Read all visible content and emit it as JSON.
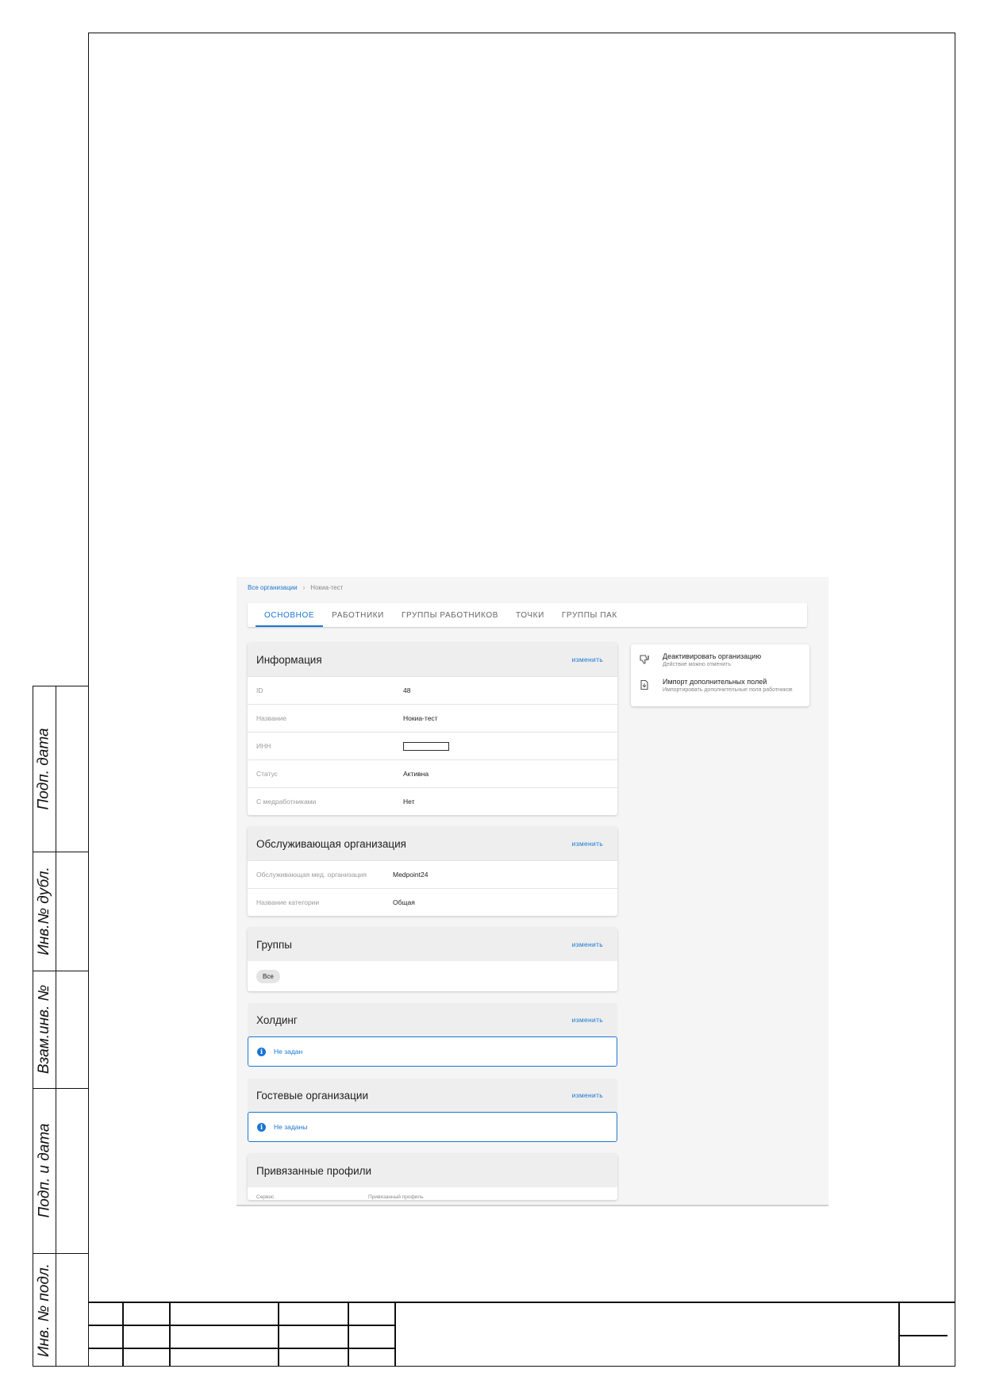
{
  "side_labels": [
    "Подп. дата",
    "Инв.№ дубл.",
    "Взам.инв. №",
    "Подп. и дата",
    "Инв. № подл."
  ],
  "breadcrumb": {
    "root": "Все организации",
    "separator": "›",
    "current": "Нокиа-тест"
  },
  "tabs": [
    {
      "label": "ОСНОВНОЕ",
      "active": true
    },
    {
      "label": "РАБОТНИКИ",
      "active": false
    },
    {
      "label": "ГРУППЫ РАБОТНИКОВ",
      "active": false
    },
    {
      "label": "ТОЧКИ",
      "active": false
    },
    {
      "label": "ГРУППЫ ПАК",
      "active": false
    }
  ],
  "info_card": {
    "title": "Информация",
    "action": "изменить",
    "rows": [
      {
        "label": "ID",
        "value": "48"
      },
      {
        "label": "Название",
        "value": "Нокиа-тест"
      },
      {
        "label": "ИНН",
        "value": ""
      },
      {
        "label": "Статус",
        "value": "Активна"
      },
      {
        "label": "С медработниками",
        "value": "Нет"
      }
    ]
  },
  "service_card": {
    "title": "Обслуживающая организация",
    "action": "изменить",
    "rows": [
      {
        "label": "Обслуживающая мед. организация",
        "value": "Medpoint24"
      },
      {
        "label": "Название категории",
        "value": "Общая"
      }
    ]
  },
  "groups_card": {
    "title": "Группы",
    "action": "изменить",
    "chip": "Все"
  },
  "holding_card": {
    "title": "Холдинг",
    "action": "изменить",
    "notice": "Не задан",
    "notice_icon": "info-icon"
  },
  "guest_card": {
    "title": "Гостевые организации",
    "action": "изменить",
    "notice": "Не заданы",
    "notice_icon": "info-icon"
  },
  "profiles_card": {
    "title": "Привязанные профили",
    "col1": "Сервис",
    "col2": "Привязанный профиль"
  },
  "actions": [
    {
      "icon": "thumb-down-icon",
      "title": "Деактивировать организацию",
      "subtitle": "Действие можно отменить"
    },
    {
      "icon": "file-import-icon",
      "title": "Импорт дополнительных полей",
      "subtitle": "Импортировать дополнительные поля работников"
    }
  ],
  "colors": {
    "accent": "#1976d2",
    "card_header": "#eeeeee",
    "page_bg": "#f5f5f5"
  }
}
